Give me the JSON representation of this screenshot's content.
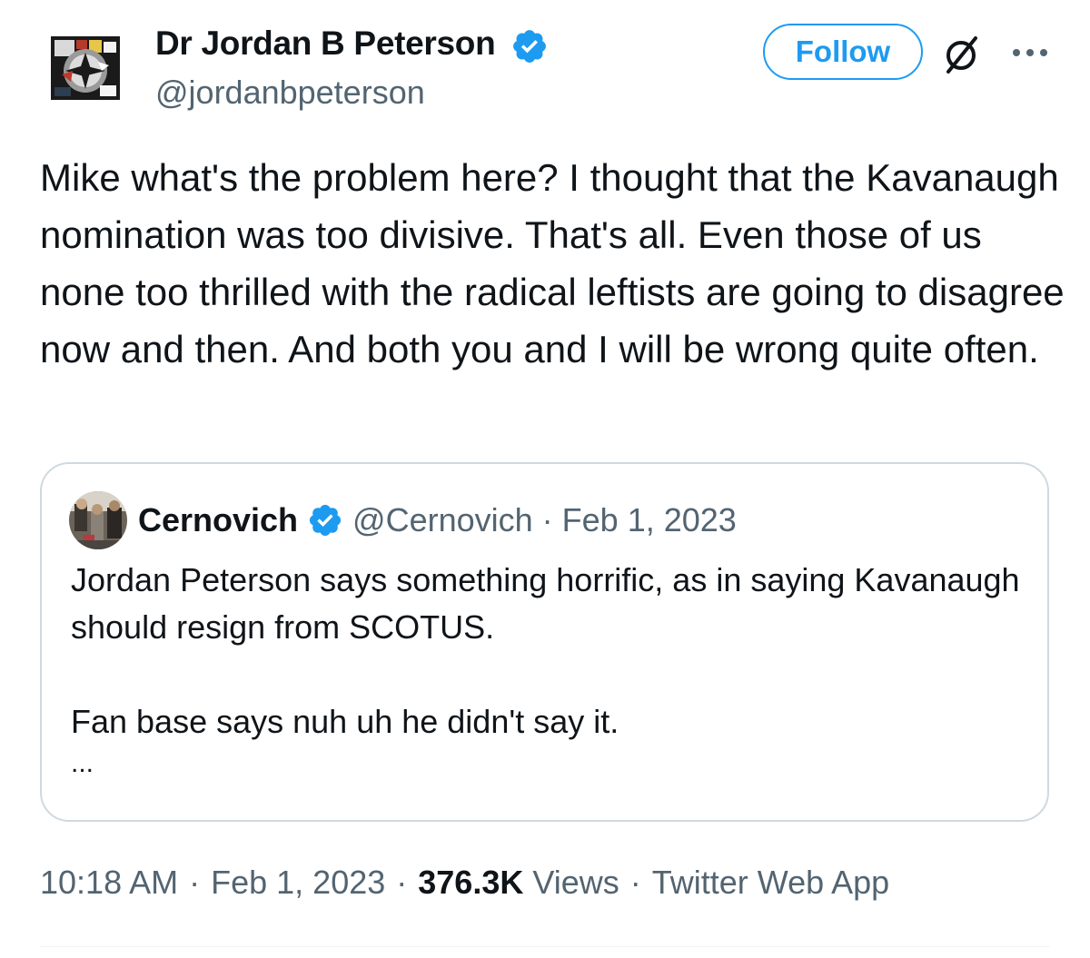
{
  "tweet": {
    "author": {
      "name": "Dr Jordan B Peterson",
      "handle": "@jordanbpeterson",
      "verified": true,
      "avatar_icon": "geometric-logo-avatar"
    },
    "header_actions": {
      "follow_label": "Follow",
      "grok_icon": "grok-slash-icon",
      "more_icon": "more-dots-icon"
    },
    "text": "Mike what's the problem here? I thought that the Kavanaugh nomination was too divisive. That's all. Even those of us none too thrilled with the radical leftists are going to disagree now and then. And both you and I will be wrong quite often.",
    "quoted": {
      "author_name": "Cernovich",
      "handle": "@Cernovich",
      "separator": "·",
      "date": "Feb 1, 2023",
      "verified": true,
      "text_p1": "Jordan Peterson says something horrific, as in saying Kavanaugh should resign from SCOTUS.",
      "text_p2": "Fan base says nuh uh he didn't say it.",
      "truncation": "..."
    },
    "meta": {
      "time": "10:18 AM",
      "sep": "·",
      "date": "Feb 1, 2023",
      "views_count": "376.3K",
      "views_label": "Views",
      "source": "Twitter Web App"
    }
  },
  "colors": {
    "accent": "#1d9bf0",
    "text_primary": "#0f1419",
    "text_secondary": "#536471",
    "border": "#cfd9de"
  }
}
